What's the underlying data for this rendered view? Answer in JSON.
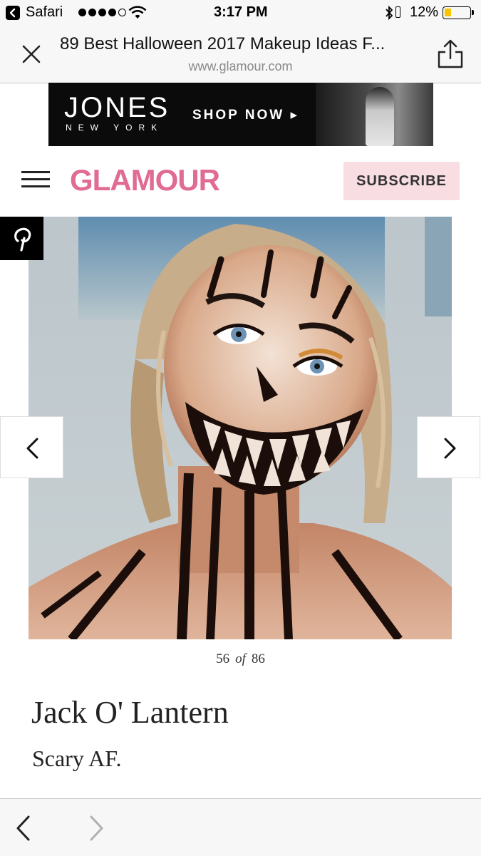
{
  "status_bar": {
    "app": "Safari",
    "time": "3:17 PM",
    "battery_pct": "12%",
    "battery_level": 0.12,
    "signal_dots": 4,
    "signal_total": 5
  },
  "browser": {
    "page_title": "89 Best Halloween 2017 Makeup Ideas F...",
    "url": "www.glamour.com",
    "close_icon": "close-icon",
    "share_icon": "share-icon"
  },
  "ad": {
    "brand": "JONES",
    "sub": "NEW YORK",
    "cta": "SHOP NOW ▸"
  },
  "header": {
    "logo": "GLAMOUR",
    "subscribe": "SUBSCRIBE",
    "logo_color": "#e06b93",
    "subscribe_bg": "#f8dde3"
  },
  "gallery": {
    "current": "56",
    "of": "of",
    "total": "86",
    "title": "Jack O' Lantern",
    "caption": "Scary AF."
  }
}
